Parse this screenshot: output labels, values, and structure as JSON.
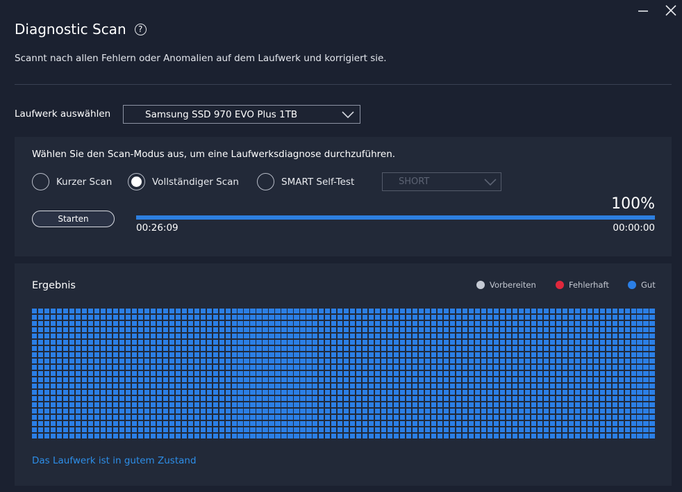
{
  "window": {
    "minimize_icon": "minimize-icon",
    "close_icon": "close-icon"
  },
  "header": {
    "title": "Diagnostic Scan",
    "help_glyph": "?",
    "subtitle": "Scannt nach allen Fehlern oder Anomalien auf dem Laufwerk und korrigiert sie."
  },
  "drive": {
    "label": "Laufwerk auswählen",
    "selected": "Samsung SSD 970 EVO Plus 1TB"
  },
  "scan": {
    "heading": "Wählen Sie den Scan-Modus aus, um eine Laufwerksdiagnose durchzuführen.",
    "modes": [
      {
        "label": "Kurzer Scan",
        "selected": false
      },
      {
        "label": "Vollständiger Scan",
        "selected": true
      },
      {
        "label": "SMART Self-Test",
        "selected": false
      }
    ],
    "smart_option": "SHORT",
    "start_label": "Starten",
    "progress_percent_text": "100%",
    "progress_value": 1.0,
    "elapsed": "00:26:09",
    "remaining": "00:00:00"
  },
  "result": {
    "title": "Ergebnis",
    "legend": [
      {
        "label": "Vorbereiten",
        "color": "#c5cad4"
      },
      {
        "label": "Fehlerhaft",
        "color": "#e0283c"
      },
      {
        "label": "Gut",
        "color": "#2b7fe6"
      }
    ],
    "status": "Das Laufwerk ist in gutem Zustand"
  },
  "colors": {
    "accent": "#2b7fe6",
    "background": "#1b2130",
    "panel": "#222938"
  }
}
